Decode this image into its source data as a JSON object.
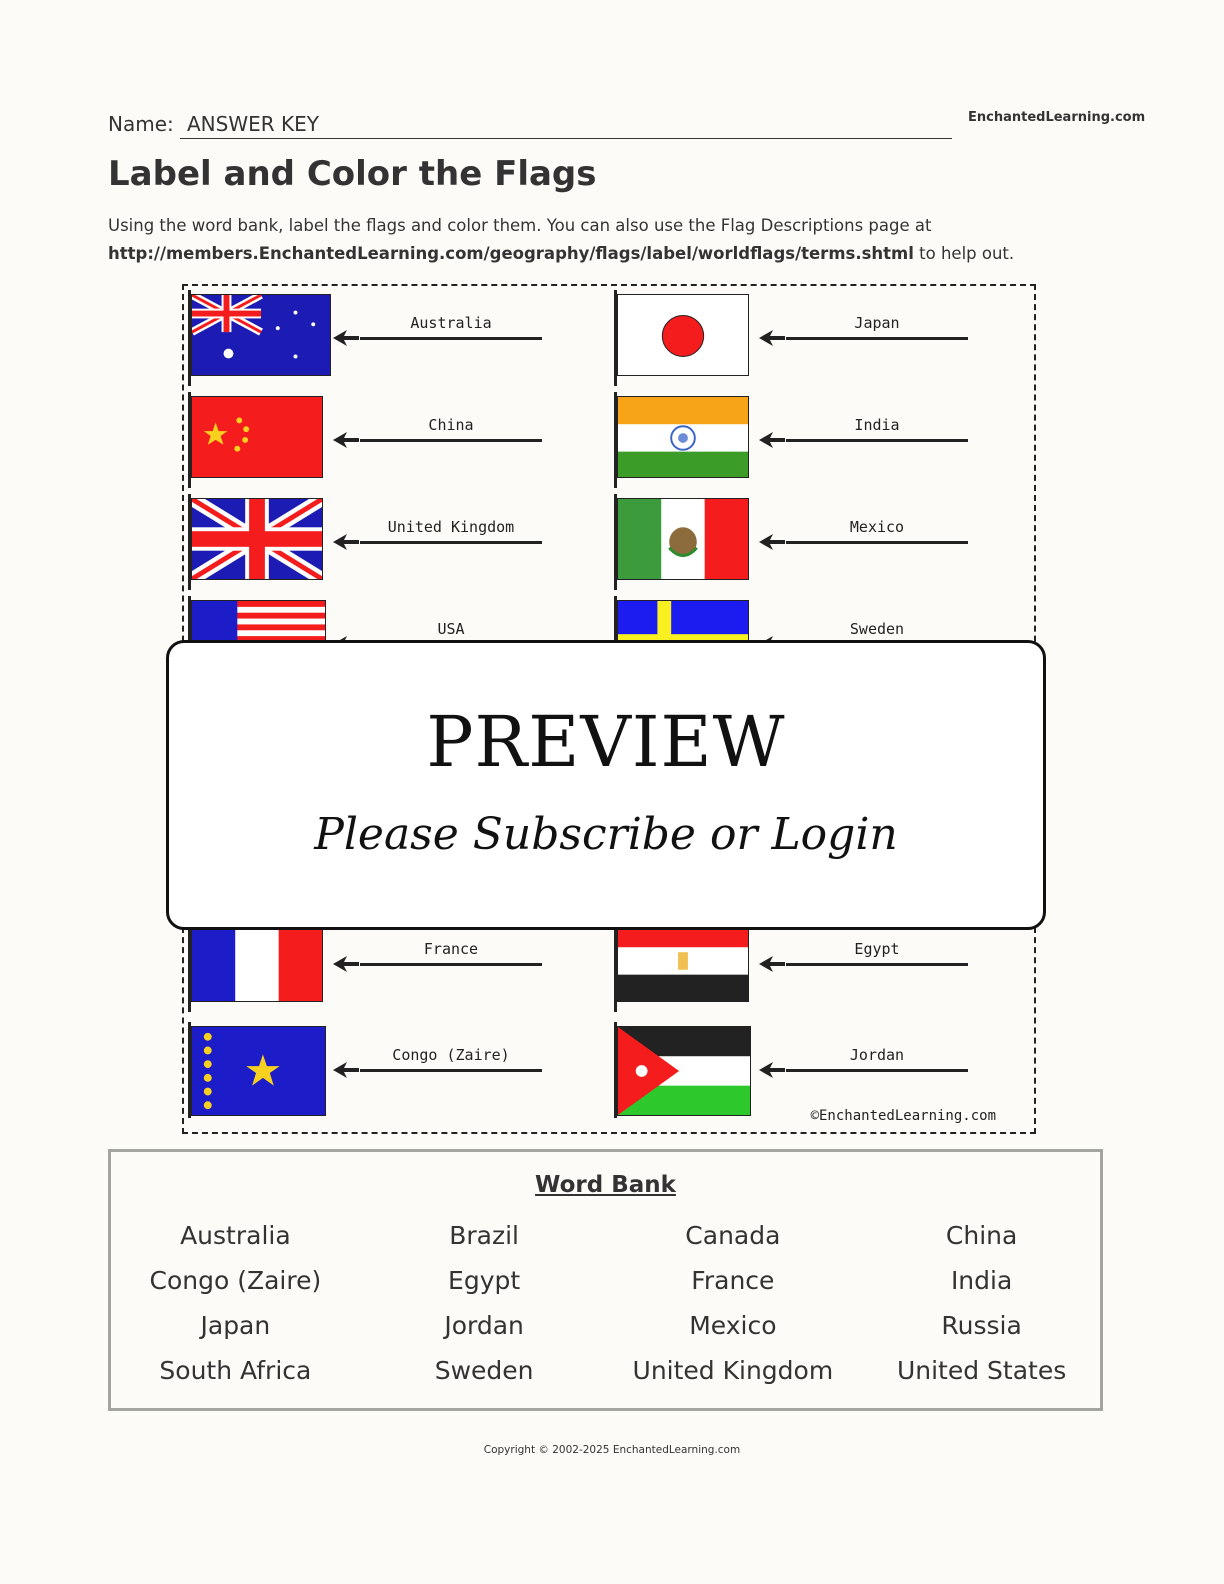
{
  "header": {
    "name_label": "Name:",
    "name_value": "ANSWER KEY",
    "brand": "EnchantedLearning.com"
  },
  "title": "Label and Color the Flags",
  "instructions": {
    "line1": "Using the word bank, label the flags and color them. You can also use the Flag Descriptions page at",
    "url": "http://members.EnchantedLearning.com/geography/flags/label/worldflags/terms.shtml",
    "tail": " to help out."
  },
  "flags": {
    "left": [
      {
        "country": "Australia",
        "icon": "australia-flag-icon"
      },
      {
        "country": "China",
        "icon": "china-flag-icon"
      },
      {
        "country": "United Kingdom",
        "icon": "uk-flag-icon"
      },
      {
        "country": "USA",
        "icon": "usa-flag-icon"
      },
      {
        "country": "France",
        "icon": "france-flag-icon"
      },
      {
        "country": "Congo (Zaire)",
        "icon": "congo-flag-icon"
      }
    ],
    "right": [
      {
        "country": "Japan",
        "icon": "japan-flag-icon"
      },
      {
        "country": "India",
        "icon": "india-flag-icon"
      },
      {
        "country": "Mexico",
        "icon": "mexico-flag-icon"
      },
      {
        "country": "Sweden",
        "icon": "sweden-flag-icon"
      },
      {
        "country": "Egypt",
        "icon": "egypt-flag-icon"
      },
      {
        "country": "Jordan",
        "icon": "jordan-flag-icon"
      }
    ],
    "sheet_copyright": "©EnchantedLearning.com"
  },
  "preview": {
    "title": "PREVIEW",
    "subtitle": "Please Subscribe or Login"
  },
  "word_bank": {
    "title": "Word Bank",
    "words": [
      "Australia",
      "Brazil",
      "Canada",
      "China",
      "Congo (Zaire)",
      "Egypt",
      "France",
      "India",
      "Japan",
      "Jordan",
      "Mexico",
      "Russia",
      "South Africa",
      "Sweden",
      "United Kingdom",
      "United States"
    ]
  },
  "footer": "Copyright © 2002-2025 EnchantedLearning.com",
  "colors": {
    "red": "#f41c1c",
    "blue": "#1c1cc8",
    "yellow": "#f8d020",
    "green": "#3c9c28",
    "orange": "#f8a418",
    "black": "#222222"
  }
}
